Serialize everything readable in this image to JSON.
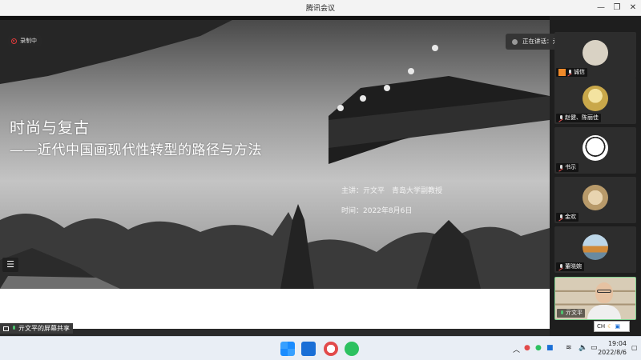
{
  "window": {
    "title": "腾讯会议"
  },
  "recording": {
    "label": "录制中"
  },
  "slide": {
    "title": "时尚与复古",
    "subtitle": "——近代中国画现代性转型的路径与方法",
    "speaker": "主讲：亓文平　青岛大学副教授",
    "time": "时间：2022年8月6日"
  },
  "share": {
    "label": "亓文平的屏幕共享"
  },
  "speaking": {
    "label": "正在讲话：亓文平；"
  },
  "participants": [
    {
      "name": "诚信",
      "mic": "muted"
    },
    {
      "name": "赵健、陈丽佳",
      "mic": "muted"
    },
    {
      "name": "书示",
      "mic": "muted"
    },
    {
      "name": "金欢",
      "mic": "muted"
    },
    {
      "name": "董晓婉",
      "mic": "muted"
    },
    {
      "name": "亓文平",
      "mic": "on"
    }
  ],
  "ime": {
    "label": "CH"
  },
  "clock": {
    "time": "19:04",
    "date": "2022/8/6"
  },
  "colors": {
    "accent": "#1a6fd6",
    "rec": "#e03b3b",
    "mic_on": "#4ec36e"
  }
}
